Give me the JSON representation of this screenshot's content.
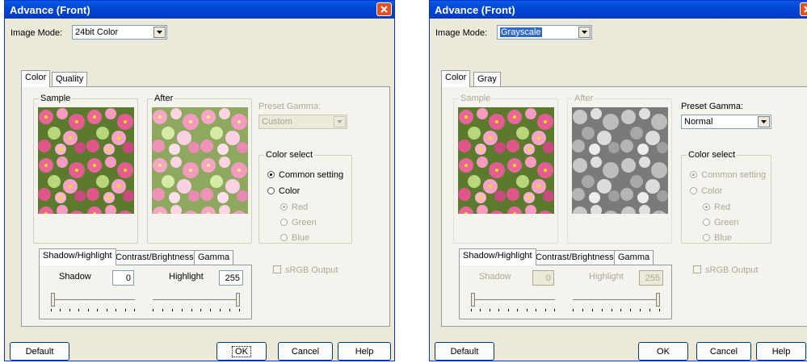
{
  "dialog_left": {
    "title": "Advance (Front)",
    "image_mode_label": "Image Mode:",
    "image_mode_value": "24bit Color",
    "tabs": [
      "Color",
      "Quality"
    ],
    "sample_label": "Sample",
    "after_label": "After",
    "preset_gamma_label": "Preset Gamma:",
    "preset_gamma_value": "Custom",
    "color_select_label": "Color select",
    "common_setting": "Common setting",
    "color": "Color",
    "red": "Red",
    "green": "Green",
    "blue": "Blue",
    "subtabs": [
      "Shadow/Highlight",
      "Contrast/Brightness",
      "Gamma"
    ],
    "shadow_label": "Shadow",
    "shadow_value": "0",
    "highlight_label": "Highlight",
    "highlight_value": "255",
    "srgb_label": "sRGB Output",
    "buttons": {
      "default": "Default",
      "ok": "OK",
      "cancel": "Cancel",
      "help": "Help"
    }
  },
  "dialog_right": {
    "title": "Advance (Front)",
    "image_mode_label": "Image Mode:",
    "image_mode_value": "Grayscale",
    "tabs": [
      "Color",
      "Gray"
    ],
    "sample_label": "Sample",
    "after_label": "After",
    "preset_gamma_label": "Preset Gamma:",
    "preset_gamma_value": "Normal",
    "color_select_label": "Color select",
    "common_setting": "Common setting",
    "color": "Color",
    "red": "Red",
    "green": "Green",
    "blue": "Blue",
    "subtabs": [
      "Shadow/Highlight",
      "Contrast/Brightness",
      "Gamma"
    ],
    "shadow_label": "Shadow",
    "shadow_value": "0",
    "highlight_label": "Highlight",
    "highlight_value": "255",
    "srgb_label": "sRGB Output",
    "buttons": {
      "default": "Default",
      "ok": "OK",
      "cancel": "Cancel",
      "help": "Help"
    }
  },
  "icons": {
    "close": "close-icon",
    "dropdown": "chevron-down-icon"
  },
  "colors": {
    "title_bar": "#0347d6",
    "close_button": "#e14f22",
    "dialog_bg": "#ece9d8",
    "disabled_text": "#aca899"
  }
}
